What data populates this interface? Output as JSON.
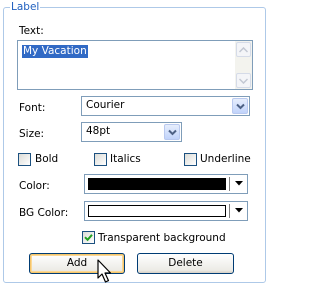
{
  "group": {
    "title": "Label"
  },
  "text_field": {
    "label": "Text:",
    "value": "My Vacation"
  },
  "font": {
    "label": "Font:",
    "value": "Courier"
  },
  "size": {
    "label": "Size:",
    "value": "48pt"
  },
  "styles": {
    "bold": {
      "label": "Bold",
      "checked": false
    },
    "italics": {
      "label": "Italics",
      "checked": false
    },
    "underline": {
      "label": "Underline",
      "checked": false
    }
  },
  "color": {
    "label": "Color:",
    "value": "#000000"
  },
  "bg_color": {
    "label": "BG Color:",
    "value": "#ffffff"
  },
  "transparent_background": {
    "label": "Transparent background",
    "checked": true
  },
  "buttons": {
    "add": "Add",
    "delete": "Delete"
  },
  "colors": {
    "group_title": "#1f5fbf",
    "group_border": "#aec9e8",
    "selection": "#316ac5",
    "checkmark": "#21a121"
  }
}
